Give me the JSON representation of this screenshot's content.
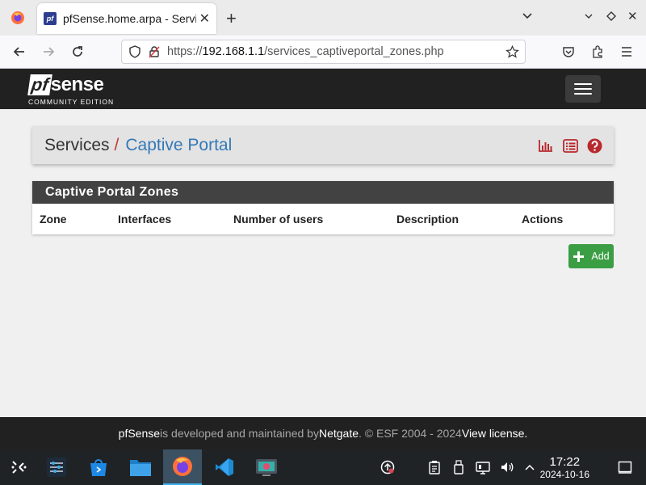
{
  "browser": {
    "tab_title": "pfSense.home.arpa - Services: Captive Portal",
    "tab_favicon_text": "pf",
    "url_prefix": "https://",
    "url_host": "192.168.1.1",
    "url_path": "/services_captiveportal_zones.php"
  },
  "pfsense": {
    "logo_pf": "pf",
    "logo_sense": "sense",
    "logo_edition": "COMMUNITY EDITION"
  },
  "breadcrumb": {
    "parent": "Services",
    "separator": "/",
    "current": "Captive Portal"
  },
  "zones_panel": {
    "title": "Captive Portal Zones",
    "columns": [
      "Zone",
      "Interfaces",
      "Number of users",
      "Description",
      "Actions"
    ]
  },
  "add_button": {
    "label": "Add"
  },
  "footer": {
    "brand": "pfSense",
    "text1": " is developed and maintained by ",
    "company": "Netgate",
    "text2": ". © ESF 2004 - 2024 ",
    "license": "View license."
  },
  "taskbar": {
    "time": "17:22",
    "date": "2024-10-16"
  },
  "colors": {
    "header_bg": "#212121",
    "breadcrumb_link": "#3479b7",
    "breadcrumb_sep": "#c23838",
    "add_button": "#3b9e45",
    "icon_red": "#b8292f"
  }
}
